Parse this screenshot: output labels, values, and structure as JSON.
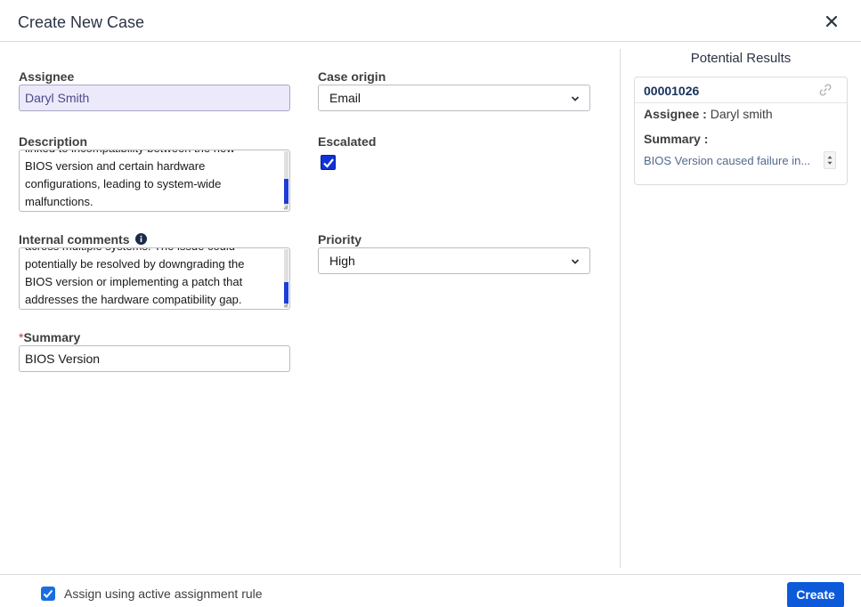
{
  "dialog": {
    "title": "Create New Case"
  },
  "form": {
    "assignee": {
      "label": "Assignee",
      "value": "Daryl Smith"
    },
    "case_origin": {
      "label": "Case origin",
      "value": "Email"
    },
    "description": {
      "label": "Description",
      "lines": [
        "linked to incompatibility between the new",
        "BIOS version and certain hardware",
        "configurations, leading to system-wide",
        "malfunctions."
      ]
    },
    "escalated": {
      "label": "Escalated",
      "checked": true
    },
    "internal_comments": {
      "label": "Internal comments",
      "lines": [
        "across multiple systems. The issue could",
        "potentially be resolved by downgrading the",
        "BIOS version or implementing a patch that",
        "addresses the hardware compatibility gap."
      ]
    },
    "priority": {
      "label": "Priority",
      "value": "High"
    },
    "summary": {
      "required_mark": "*",
      "label": "Summary",
      "value": "BIOS Version"
    }
  },
  "results": {
    "title": "Potential Results",
    "cards": [
      {
        "case_number": "00001026",
        "assignee_label": "Assignee :",
        "assignee_value": "Daryl smith",
        "summary_label": "Summary :",
        "summary_value": "BIOS Version caused failure in..."
      }
    ]
  },
  "footer": {
    "assign_rule_label": "Assign using active assignment rule",
    "assign_rule_checked": true,
    "create_label": "Create"
  },
  "colors": {
    "primary_button": "#0c5ad9",
    "checkbox_blue": "#1033d9",
    "assignee_field_bg": "#ece9fb"
  },
  "icons": {
    "close": "close-icon",
    "dropdown": "chevron-down-icon",
    "info": "info-icon",
    "link": "link-icon",
    "check": "checkmark-icon"
  }
}
